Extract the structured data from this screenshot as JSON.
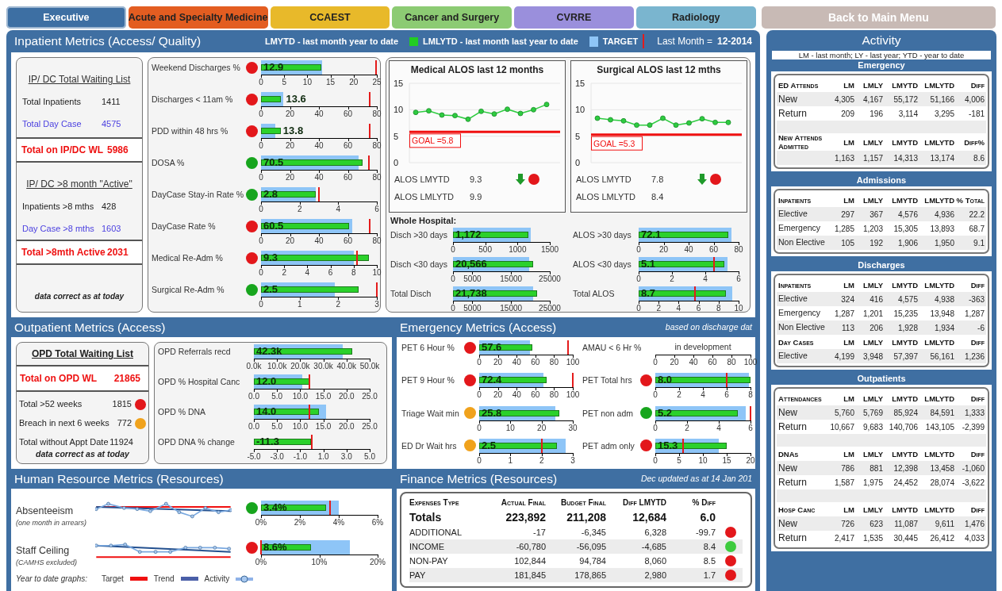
{
  "nav_tabs": [
    {
      "label": "Executive",
      "color": "#3d6fa3",
      "selected": true
    },
    {
      "label": "Acute and Specialty Medicine",
      "color": "#e35d21",
      "selected": false
    },
    {
      "label": "CCAEST",
      "color": "#e8b92a",
      "selected": false
    },
    {
      "label": "Cancer and Surgery",
      "color": "#8ccb73",
      "selected": false
    },
    {
      "label": "CVRRE",
      "color": "#9a8fdc",
      "selected": false
    },
    {
      "label": "Radiology",
      "color": "#7ab5cf",
      "selected": false
    }
  ],
  "back_button": {
    "label": "Back to Main Menu"
  },
  "inpatient": {
    "title": "Inpatient Metrics (Access/ Quality)",
    "legend": {
      "lmytd": "LMYTD - last month year to date",
      "lmlytd": "LMLYTD - last month last year to date",
      "target": "TARGET",
      "last_month_label": "Last Month =",
      "last_month": "12-2014"
    },
    "lists": [
      {
        "title": "IP/ DC Total Waiting List",
        "rows": [
          {
            "label": "Total Inpatients",
            "value": "1411",
            "kind": "plain"
          },
          {
            "label": "Total Day Case",
            "value": "4575",
            "kind": "daycase"
          }
        ],
        "total": {
          "label": "Total on IP/DC WL",
          "value": "5986"
        }
      },
      {
        "title": "IP/ DC >8 month \"Active\"",
        "rows": [
          {
            "label": "Inpatients >8 mths",
            "value": "428",
            "kind": "plain"
          },
          {
            "label": "Day Case >8 mths",
            "value": "1603",
            "kind": "daycase"
          }
        ],
        "total": {
          "label": "Total >8mth Active",
          "value": "2031"
        }
      }
    ],
    "note": "data correct as at today",
    "metrics": [
      {
        "label": "Weekend Discharges %",
        "color": "#e3171b",
        "value": "12.9",
        "level": 0.52,
        "target": {
          "level": 0.53
        },
        "marker": {
          "level": 0.99
        },
        "ticks": [
          "0",
          "5",
          "10",
          "15",
          "20",
          "25"
        ]
      },
      {
        "label": "Discharges < 11am %",
        "color": "#e3171b",
        "value": "13.6",
        "level": 0.17,
        "target": {
          "level": 0.195
        },
        "marker": {
          "level": 0.94
        },
        "ticks": [
          "0",
          "20",
          "40",
          "60",
          "80"
        ]
      },
      {
        "label": "PDD within 48 hrs %",
        "color": "#e3171b",
        "value": "13.8",
        "level": 0.17,
        "target": {
          "level": 0.12
        },
        "marker": {
          "level": 0.94
        },
        "ticks": [
          "0",
          "20",
          "40",
          "60",
          "80"
        ]
      },
      {
        "label": "DOSA %",
        "color": "#17a51d",
        "value": "70.5",
        "level": 0.88,
        "target": {
          "level": 0.845
        },
        "marker": {
          "level": 0.93
        },
        "ticks": [
          "0",
          "20",
          "40",
          "60",
          "80"
        ]
      },
      {
        "label": "DayCase Stay-in Rate %",
        "color": "#17a51d",
        "value": "2.8",
        "level": 0.47,
        "target": {
          "level": 0.47
        },
        "marker": {
          "level": 0.5
        },
        "ticks": [
          "0",
          "2",
          "4",
          "6"
        ]
      },
      {
        "label": "DayCase Rate %",
        "color": "#e3171b",
        "value": "60.5",
        "level": 0.76,
        "target": {
          "level": 0.79
        },
        "marker": {
          "level": 0.94
        },
        "ticks": [
          "0",
          "20",
          "40",
          "60",
          "80"
        ]
      },
      {
        "label": "Medical Re-Adm %",
        "color": "#e3171b",
        "value": "9.3",
        "level": 0.93,
        "target": {
          "level": 0.8
        },
        "marker": {
          "level": 0.83
        },
        "ticks": [
          "0",
          "2",
          "4",
          "6",
          "8",
          "10"
        ]
      },
      {
        "label": "Surgical Re-Adm %",
        "color": "#17a51d",
        "value": "2.5",
        "level": 0.84,
        "target": {
          "level": 0.64
        },
        "marker": {
          "level": 1.0
        },
        "ticks": [
          "0",
          "1",
          "2",
          "3"
        ]
      }
    ],
    "alos": [
      {
        "title": "Medical ALOS last 12 months",
        "chart_data": {
          "type": "line",
          "series": [
            {
              "color": "#2ecc40",
              "marker": "o",
              "values": [
                9.5,
                9.8,
                9.0,
                8.9,
                8.2,
                9.7,
                9.2,
                10.1,
                9.3,
                10.0,
                11.0
              ]
            }
          ],
          "ylim": [
            0,
            15
          ],
          "yticks": [
            0,
            5,
            10,
            15
          ],
          "ref_lines": [
            {
              "axis": "y",
              "value": 5.8,
              "label": "GOAL =5.8",
              "color": "#f01010"
            }
          ]
        },
        "stats": [
          {
            "label": "ALOS LMYTD",
            "value": "9.3",
            "falling": true,
            "color": "#e3171b"
          },
          {
            "label": "ALOS LMLYTD",
            "value": "9.9"
          }
        ]
      },
      {
        "title": "Surgical ALOS last 12 mths",
        "chart_data": {
          "type": "line",
          "series": [
            {
              "color": "#2ecc40",
              "marker": "o",
              "values": [
                8.4,
                8.1,
                7.9,
                7.1,
                7.1,
                8.4,
                7.1,
                7.5,
                8.3,
                7.6,
                7.6
              ]
            }
          ],
          "ylim": [
            0,
            15
          ],
          "yticks": [
            0,
            5,
            10,
            15
          ],
          "ref_lines": [
            {
              "axis": "y",
              "value": 5.3,
              "label": "GOAL =5.3",
              "color": "#f01010"
            }
          ]
        },
        "stats": [
          {
            "label": "ALOS LMYTD",
            "value": "7.8",
            "falling": true,
            "color": "#e3171b"
          },
          {
            "label": "ALOS LMLYTD",
            "value": "8.4"
          }
        ]
      }
    ],
    "whole_hospital": {
      "title": "Whole Hospital:",
      "left": [
        {
          "label": "Disch >30 days",
          "value": "1,172",
          "level": 0.78,
          "target": {
            "level": 0.8
          },
          "ticks": [
            "0",
            "500",
            "1000",
            "1500"
          ]
        },
        {
          "label": "Disch <30 days",
          "value": "20,566",
          "level": 0.83,
          "target": {
            "level": 0.79
          },
          "ticks": [
            "0",
            "5000",
            "15000",
            "25000"
          ]
        },
        {
          "label": "Total Disch",
          "value": "21,738",
          "level": 0.87,
          "target": {
            "level": 0.83
          },
          "ticks": [
            "0",
            "5000",
            "15000",
            "25000"
          ]
        }
      ],
      "right": [
        {
          "label": "ALOS >30 days",
          "value": "72.1",
          "level": 0.9,
          "target": {
            "level": 0.93
          },
          "ticks": [
            "0",
            "20",
            "40",
            "60",
            "80"
          ]
        },
        {
          "label": "ALOS <30 days",
          "value": "5.1",
          "level": 0.86,
          "target": {
            "level": 0.89
          },
          "marker": {
            "level": 0.75
          },
          "ticks": [
            "0",
            "2",
            "4",
            "6"
          ]
        },
        {
          "label": "Total ALOS",
          "value": "8.7",
          "level": 0.87,
          "target": {
            "level": 0.94
          },
          "marker": {
            "level": 0.56
          },
          "ticks": [
            "0",
            "2",
            "4",
            "6",
            "8",
            "10"
          ]
        }
      ]
    }
  },
  "outpatient": {
    "title": "Outpatient Metrics (Access)",
    "waiting_list": {
      "title": "OPD Total Waiting List",
      "total": {
        "label": "Total on OPD WL",
        "value": "21865"
      },
      "rows": [
        {
          "label": "Total >52 weeks",
          "value": "1815",
          "color": "#e3171b"
        },
        {
          "label": "Breach in next 6 weeks",
          "value": "772",
          "color": "#f0a21c"
        },
        {
          "label": "Total without Appt Date",
          "value": "11924"
        }
      ],
      "note": "data correct as at today"
    },
    "metrics": [
      {
        "label": "OPD Referrals recd",
        "value": "42.3k",
        "level": 0.85,
        "target": {
          "level": 0.77
        },
        "ticks": [
          "0.0k",
          "10.0k",
          "20.0k",
          "30.0k",
          "40.0k",
          "50.0k"
        ]
      },
      {
        "label": "OPD % Hospital Canc",
        "value": "12.0",
        "level": 0.48,
        "target": {
          "level": 0.42
        },
        "marker": {
          "level": 0.48
        },
        "ticks": [
          "0.0",
          "5.0",
          "10.0",
          "15.0",
          "20.0",
          "25.0"
        ]
      },
      {
        "label": "OPD % DNA",
        "value": "14.0",
        "level": 0.56,
        "target": {
          "level": 0.62
        },
        "marker": {
          "level": 0.48
        },
        "ticks": [
          "0.0",
          "5.0",
          "10.0",
          "15.0",
          "20.0",
          "25.0"
        ]
      },
      {
        "label": "OPD DNA % change",
        "value": "-11.3",
        "level": 0.49,
        "marker": {
          "level": 0.5
        },
        "ticks": [
          "-5.0",
          "-3.0",
          "-1.0",
          "1.0",
          "3.0",
          "5.0"
        ]
      }
    ]
  },
  "hr": {
    "title": "Human Resource Metrics (Resources)",
    "rows": [
      {
        "label": "Absenteeism",
        "note": "(one month in arrears)",
        "metric": {
          "color": "#17a51d",
          "value": "3.4%",
          "level": 0.56,
          "target": {
            "level": 0.67
          },
          "marker": {
            "level": 0.59
          },
          "ticks": [
            "0%",
            "2%",
            "4%",
            "6%"
          ]
        }
      },
      {
        "label": "Staff Ceiling",
        "note": "(CAMHS excluded)",
        "metric": {
          "color": "#e3171b",
          "value": "8.6%",
          "level": 0.43,
          "target": {
            "level": 0.76
          },
          "marker": {
            "level": 0.0
          },
          "ticks": [
            "0%",
            "10%",
            "20%"
          ]
        }
      }
    ],
    "legend": {
      "title": "Year to date graphs:",
      "items": [
        {
          "label": "Target",
          "kind": "target"
        },
        {
          "label": "Trend",
          "kind": "trend"
        },
        {
          "label": "Activity",
          "kind": "activity"
        }
      ]
    }
  },
  "emergency": {
    "title": "Emergency Metrics (Access)",
    "note": "based on discharge dat",
    "left": [
      {
        "label": "PET 6 Hour %",
        "color": "#e3171b",
        "value": "57.6",
        "level": 0.57,
        "target": {
          "level": 0.54
        },
        "marker": {
          "level": 0.95
        },
        "ticks": [
          "0",
          "20",
          "40",
          "60",
          "80",
          "100"
        ]
      },
      {
        "label": "PET 9 Hour %",
        "color": "#e3171b",
        "value": "72.4",
        "level": 0.72,
        "target": {
          "level": 0.69
        },
        "marker": {
          "level": 1.0
        },
        "ticks": [
          "0",
          "20",
          "40",
          "60",
          "80",
          "100"
        ]
      },
      {
        "label": "Triage Wait min",
        "color": "#f0a21c",
        "value": "25.8",
        "level": 0.86,
        "target": {
          "level": 0.81
        },
        "ticks": [
          "0",
          "10",
          "20",
          "30"
        ]
      },
      {
        "label": "ED Dr Wait hrs",
        "color": "#f0a21c",
        "value": "2.5",
        "level": 0.83,
        "target": {
          "level": 0.92
        },
        "marker": {
          "level": 0.67
        },
        "ticks": [
          "0",
          "1",
          "2",
          "3"
        ]
      }
    ],
    "right": [
      {
        "kind": "development",
        "label": "AMAU < 6 Hr %",
        "status_text": "in development",
        "ticks": [
          "0",
          "20",
          "40",
          "60",
          "80",
          "100"
        ]
      },
      {
        "kind": "bullet",
        "label": "PET Total hrs",
        "color": "#e3171b",
        "value": "8.0",
        "level": 1.0,
        "target": {
          "level": 0.98
        },
        "marker": {
          "level": 0.75
        },
        "ticks": [
          "0",
          "2",
          "4",
          "6",
          "8"
        ]
      },
      {
        "kind": "bullet",
        "label": "PET non adm",
        "color": "#17a51d",
        "value": "5.2",
        "level": 0.87,
        "target": {
          "level": 0.95
        },
        "marker": {
          "level": 1.0
        },
        "ticks": [
          "0",
          "2",
          "4",
          "6"
        ]
      },
      {
        "kind": "bullet",
        "label": "PET adm only",
        "color": "#e3171b",
        "value": "15.3",
        "level": 0.75,
        "target": {
          "level": 0.67
        },
        "marker": {
          "level": 0.29
        },
        "ticks": [
          "0",
          "5",
          "10",
          "15",
          "20"
        ]
      }
    ]
  },
  "finance": {
    "title": "Finance Metrics (Resources)",
    "note": "Dec updated as at 14 Jan 201",
    "columns": [
      "Expenses Type",
      "Actual Final",
      "Budget Final",
      "Diff LMYTD",
      "% Diff"
    ],
    "totals": {
      "cells": [
        "Totals",
        "223,892",
        "211,208",
        "12,684",
        "6.0"
      ]
    },
    "rows": [
      {
        "cells": [
          "ADDITIONAL",
          "-17",
          "-6,345",
          "6,328",
          "-99.7"
        ],
        "color": "#e3171b"
      },
      {
        "cells": [
          "INCOME",
          "-60,780",
          "-56,095",
          "-4,685",
          "8.4"
        ],
        "color": "#3ecb3e"
      },
      {
        "cells": [
          "NON-PAY",
          "102,844",
          "94,784",
          "8,060",
          "8.5"
        ],
        "color": "#e3171b"
      },
      {
        "cells": [
          "PAY",
          "181,845",
          "178,865",
          "2,980",
          "1.7"
        ],
        "color": "#e3171b"
      }
    ]
  },
  "activity": {
    "title": "Activity",
    "legend": "LM - last month; LY - last year; YTD - year to date",
    "sections": [
      {
        "title": "Emergency",
        "groups": [
          {
            "header": "ED Attends",
            "columns": [
              "LM",
              "LMLY",
              "LMYTD",
              "LMLYTD",
              "Diff"
            ],
            "spacer_after": true,
            "rows": [
              {
                "label": "New",
                "kind": "large",
                "cells": [
                  "4,305",
                  "4,167",
                  "55,172",
                  "51,166",
                  "4,006"
                ]
              },
              {
                "label": "Return",
                "kind": "large",
                "cells": [
                  "209",
                  "196",
                  "3,114",
                  "3,295",
                  "-181"
                ]
              }
            ]
          },
          {
            "header": "New Attends Admitted",
            "columns": [
              "LM",
              "LMLY",
              "LMYTD",
              "LMLYTD",
              "Diff%"
            ],
            "rows": [
              {
                "cells": [
                  "1,163",
                  "1,157",
                  "14,313",
                  "13,174",
                  "8.6"
                ]
              }
            ]
          }
        ]
      },
      {
        "title": "Admissions",
        "groups": [
          {
            "header": "Inpatients",
            "columns": [
              "LM",
              "LMLY",
              "LMYTD",
              "LMLYTD",
              "% Total"
            ],
            "rows": [
              {
                "label": "Elective",
                "kind": "small",
                "cells": [
                  "297",
                  "367",
                  "4,576",
                  "4,936",
                  "22.2"
                ]
              },
              {
                "label": "Emergency",
                "kind": "small",
                "cells": [
                  "1,285",
                  "1,203",
                  "15,305",
                  "13,893",
                  "68.7"
                ]
              },
              {
                "label": "Non Elective",
                "kind": "small",
                "cells": [
                  "105",
                  "192",
                  "1,906",
                  "1,950",
                  "9.1"
                ]
              }
            ]
          }
        ]
      },
      {
        "title": "Discharges",
        "groups": [
          {
            "header": "Inpatients",
            "columns": [
              "LM",
              "LMLY",
              "LMYTD",
              "LMLYTD",
              "Diff"
            ],
            "rows": [
              {
                "label": "Elective",
                "kind": "small",
                "cells": [
                  "324",
                  "416",
                  "4,575",
                  "4,938",
                  "-363"
                ]
              },
              {
                "label": "Emergency",
                "kind": "small",
                "cells": [
                  "1,287",
                  "1,201",
                  "15,235",
                  "13,948",
                  "1,287"
                ]
              },
              {
                "label": "Non Elective",
                "kind": "small",
                "cells": [
                  "113",
                  "206",
                  "1,928",
                  "1,934",
                  "-6"
                ]
              }
            ]
          },
          {
            "header": "Day Cases",
            "columns": [
              "LM",
              "LMLY",
              "LMYTD",
              "LMLYTD",
              "Diff"
            ],
            "rows": [
              {
                "label": "Elective",
                "kind": "small",
                "cells": [
                  "4,199",
                  "3,948",
                  "57,397",
                  "56,161",
                  "1,236"
                ]
              }
            ]
          }
        ]
      },
      {
        "title": "Outpatients",
        "groups": [
          {
            "header": "Attendances",
            "columns": [
              "LM",
              "LMLY",
              "LMYTD",
              "LMLYTD",
              "Diff"
            ],
            "spacer_after": true,
            "rows": [
              {
                "label": "New",
                "kind": "large",
                "cells": [
                  "5,760",
                  "5,769",
                  "85,924",
                  "84,591",
                  "1,333"
                ]
              },
              {
                "label": "Return",
                "kind": "large",
                "cells": [
                  "10,667",
                  "9,683",
                  "140,706",
                  "143,105",
                  "-2,399"
                ]
              }
            ]
          },
          {
            "header": "DNAs",
            "columns": [
              "LM",
              "LMLY",
              "LMYTD",
              "LMLYTD",
              "Diff"
            ],
            "spacer_after": true,
            "rows": [
              {
                "label": "New",
                "kind": "large",
                "cells": [
                  "786",
                  "881",
                  "12,398",
                  "13,458",
                  "-1,060"
                ]
              },
              {
                "label": "Return",
                "kind": "large",
                "cells": [
                  "1,587",
                  "1,975",
                  "24,452",
                  "28,074",
                  "-3,622"
                ]
              }
            ]
          },
          {
            "header": "Hosp Canc",
            "columns": [
              "LM",
              "LMLY",
              "LMYTD",
              "LMLYTD",
              "Diff"
            ],
            "rows": [
              {
                "label": "New",
                "kind": "large",
                "cells": [
                  "726",
                  "623",
                  "11,087",
                  "9,611",
                  "1,476"
                ]
              },
              {
                "label": "Return",
                "kind": "large",
                "cells": [
                  "2,417",
                  "1,535",
                  "30,445",
                  "26,412",
                  "4,033"
                ]
              }
            ]
          }
        ]
      }
    ]
  }
}
